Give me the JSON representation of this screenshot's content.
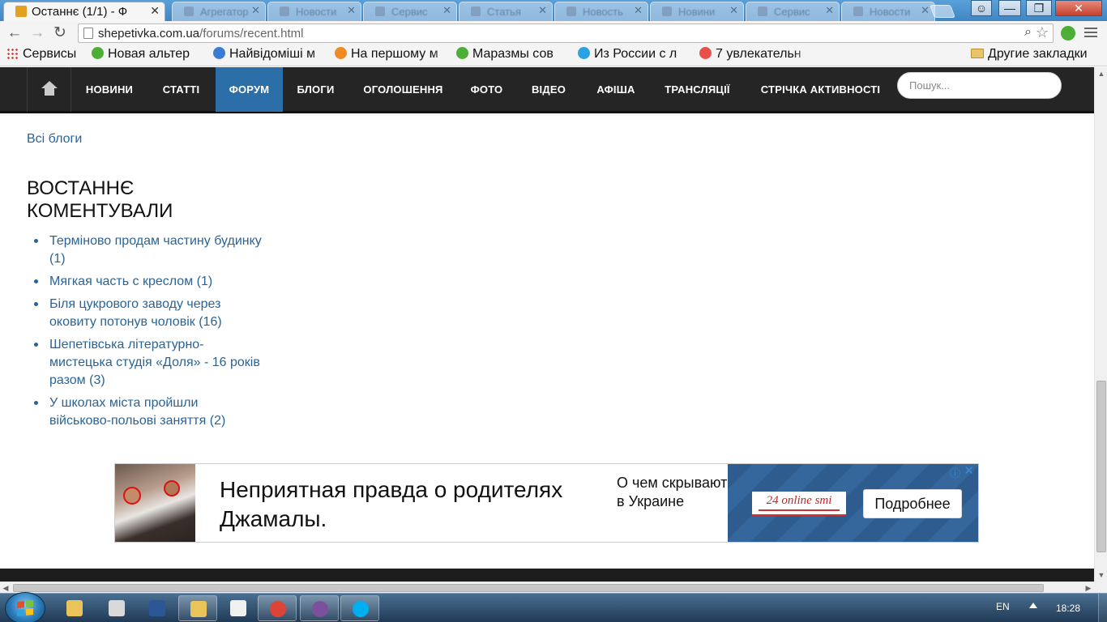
{
  "browser": {
    "active_tab": {
      "title": "Останнє (1/1) - Ф",
      "close": "✕"
    },
    "background_tabs": [
      {
        "title": "Агрегатор",
        "close": "✕"
      },
      {
        "title": "Новости",
        "close": "✕"
      },
      {
        "title": "Сервис",
        "close": "✕"
      },
      {
        "title": "Статья",
        "close": "✕"
      },
      {
        "title": "Новость",
        "close": "✕"
      },
      {
        "title": "Новини",
        "close": "✕"
      },
      {
        "title": "Сервис",
        "close": "✕"
      },
      {
        "title": "Новости",
        "close": "✕"
      }
    ],
    "window_controls": {
      "minimize": "—",
      "maximize": "❐",
      "close": "✕"
    },
    "nav": {
      "back": "←",
      "forward": "→",
      "reload": "↻"
    },
    "url": {
      "host": "shepetivka.com.ua",
      "path": "/forums/recent.html"
    },
    "omnibox_icons": {
      "zoom": "⌕",
      "star": "☆"
    },
    "bookmarks": [
      {
        "label": "Сервисы",
        "icon": "apps-grid-icon"
      },
      {
        "label": "Новая альтер",
        "icon": "feedly-icon",
        "color": "#4caf35"
      },
      {
        "label": "Найвідоміші м",
        "icon": "image-icon",
        "color": "#3a7bd5"
      },
      {
        "label": "На першому м",
        "icon": "e-icon",
        "color": "#f08a24"
      },
      {
        "label": "Маразмы сов",
        "icon": "feedly-icon",
        "color": "#4caf35"
      },
      {
        "label": "Из России с л",
        "icon": "up-icon",
        "color": "#2ba3e3"
      },
      {
        "label": "7 увлекательн",
        "icon": "pinwheel-icon",
        "color": "#e8514a"
      }
    ],
    "other_bookmarks": "Другие закладки"
  },
  "site": {
    "nav": [
      {
        "label": "НОВИНИ",
        "active": false
      },
      {
        "label": "СТАТТІ",
        "active": false
      },
      {
        "label": "ФОРУМ",
        "active": true
      },
      {
        "label": "БЛОГИ",
        "active": false
      },
      {
        "label": "ОГОЛОШЕННЯ",
        "active": false
      },
      {
        "label": "ФОТО",
        "active": false
      },
      {
        "label": "ВІДЕО",
        "active": false
      },
      {
        "label": "АФІША",
        "active": false
      },
      {
        "label": "ТРАНСЛЯЦІЇ",
        "active": false
      },
      {
        "label": "СТРІЧКА АКТИВНОСТІ",
        "active": false
      }
    ],
    "search_placeholder": "Пошук...",
    "accent_color": "#2c6ea8"
  },
  "content": {
    "all_blogs": "Всі блоги",
    "heading": "ВОСТАННЄ КОМЕНТУВАЛИ",
    "comments": [
      {
        "title": "Терміново продам частину будинку",
        "count": "(1)"
      },
      {
        "title": "Мягкая часть с креслом",
        "count": "(1)"
      },
      {
        "title": "Біля цукрового заводу через оковиту потонув чоловік",
        "count": "(16)"
      },
      {
        "title": "Шепетівська літературно-мистецька студія «Доля» - 16 років разом",
        "count": "(3)"
      },
      {
        "title": "У школах міста пройшли військово-польові заняття",
        "count": "(2)"
      }
    ]
  },
  "ad": {
    "headline": "Неприятная правда о родителях Джамалы.",
    "subtext": "О чем скрывают в Украине",
    "logo_text": "24 online smi",
    "cta": "Подробнее",
    "info_icon": "ⓘ",
    "close_icon": "✕"
  },
  "taskbar": {
    "apps": [
      {
        "name": "explorer",
        "color": "#e8c45a",
        "open": false
      },
      {
        "name": "calendar",
        "color": "#d9d9d9",
        "open": false
      },
      {
        "name": "word",
        "color": "#2b5797",
        "open": false
      },
      {
        "name": "folder",
        "color": "#e8c45a",
        "open": true
      },
      {
        "name": "apps",
        "color": "#f0f0f0",
        "open": false
      },
      {
        "name": "chrome",
        "color": "#db4437",
        "open": true
      },
      {
        "name": "viber",
        "color": "#7b519d",
        "open": true
      },
      {
        "name": "skype",
        "color": "#00aff0",
        "open": true
      }
    ],
    "language": "EN",
    "time": "18:28"
  }
}
